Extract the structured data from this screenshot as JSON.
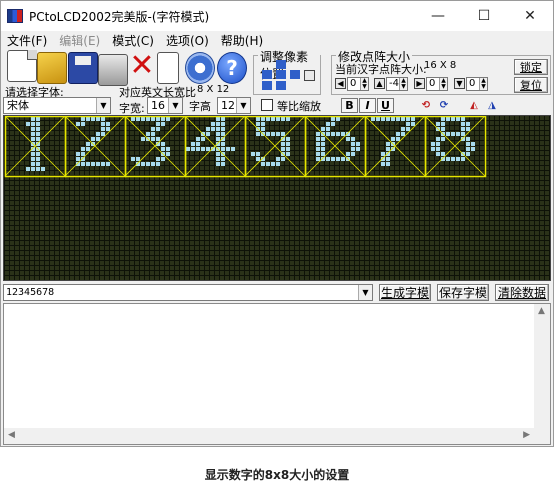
{
  "window": {
    "title": "PCtoLCD2002完美版-(字符模式)",
    "controls": {
      "minimize": "—",
      "maximize": "☐",
      "close": "✕"
    }
  },
  "menu": [
    {
      "label": "文件(F)",
      "disabled": false
    },
    {
      "label": "编辑(E)",
      "disabled": true
    },
    {
      "label": "模式(C)",
      "disabled": false
    },
    {
      "label": "选项(O)",
      "disabled": false
    },
    {
      "label": "帮助(H)",
      "disabled": false
    }
  ],
  "toolbar": {
    "icons": [
      "new-file-icon",
      "open-folder-icon",
      "save-disk-icon",
      "print-icon",
      "delete-icon",
      "document-icon",
      "settings-gear-icon",
      "help-icon"
    ],
    "delete_glyph": "✕",
    "help_glyph": "?"
  },
  "pixel_group": {
    "title": "调整像素位置"
  },
  "dot_group": {
    "title": "修改点阵大小",
    "current_label": "当前汉字点阵大小:",
    "current_value": "16 X 8",
    "lock_button": "锁定",
    "reset_button": "复位",
    "spin_values": [
      "0",
      "-4",
      "0",
      "0"
    ]
  },
  "font": {
    "select_label": "请选择字体:",
    "font_value": "宋体",
    "ratio_label": "对应英文长宽比",
    "ratio_value": "8 X 12",
    "width_label": "字宽:",
    "width_value": "16",
    "height_label": "字高",
    "height_value": "12",
    "scale_label": "等比缩放",
    "bold": "B",
    "italic": "I",
    "underline": "U"
  },
  "lcd": {
    "text": "12345678",
    "grid_color": "#0e1208",
    "bg_color": "#2b3219",
    "pixel_color": "#a9dcee",
    "frame_color": "#e6e600"
  },
  "input": {
    "value": "12345678",
    "generate_button": "生成字模",
    "save_button": "保存字模",
    "clear_button": "清除数据"
  },
  "caption": "显示数字的8x8大小的设置"
}
